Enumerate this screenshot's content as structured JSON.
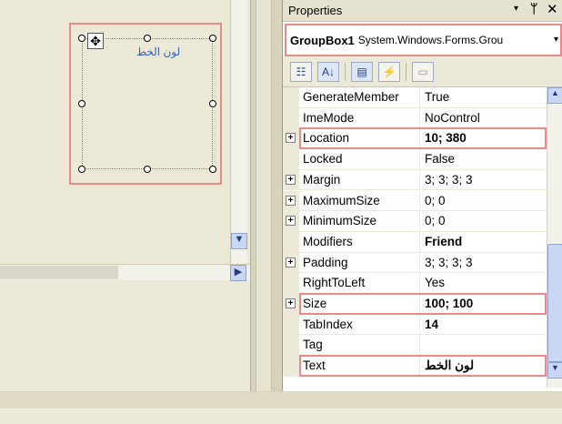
{
  "properties_panel": {
    "title": "Properties",
    "selected_object": {
      "name": "GroupBox1",
      "type": "System.Windows.Forms.Grou"
    },
    "rows": [
      {
        "name": "GenerateMember",
        "value": "True",
        "expandable": false,
        "bold": false
      },
      {
        "name": "ImeMode",
        "value": "NoControl",
        "expandable": false,
        "bold": false
      },
      {
        "name": "Location",
        "value": "10; 380",
        "expandable": true,
        "bold": true,
        "highlighted": true
      },
      {
        "name": "Locked",
        "value": "False",
        "expandable": false,
        "bold": false
      },
      {
        "name": "Margin",
        "value": "3; 3; 3; 3",
        "expandable": true,
        "bold": false
      },
      {
        "name": "MaximumSize",
        "value": "0; 0",
        "expandable": true,
        "bold": false
      },
      {
        "name": "MinimumSize",
        "value": "0; 0",
        "expandable": true,
        "bold": false
      },
      {
        "name": "Modifiers",
        "value": "Friend",
        "expandable": false,
        "bold": true
      },
      {
        "name": "Padding",
        "value": "3; 3; 3; 3",
        "expandable": true,
        "bold": false
      },
      {
        "name": "RightToLeft",
        "value": "Yes",
        "expandable": false,
        "bold": false
      },
      {
        "name": "Size",
        "value": "100; 100",
        "expandable": true,
        "bold": true,
        "highlighted": true
      },
      {
        "name": "TabIndex",
        "value": "14",
        "expandable": false,
        "bold": true
      },
      {
        "name": "Tag",
        "value": "",
        "expandable": false,
        "bold": false
      },
      {
        "name": "Text",
        "value": "لون الخط",
        "expandable": false,
        "bold": true,
        "highlighted": true
      }
    ]
  },
  "designer": {
    "groupbox_caption": "لون الخط"
  },
  "icons": {
    "dropdown": "▾",
    "pin": "ᛘ",
    "close": "✕",
    "expand": "+",
    "scroll_up": "▲",
    "scroll_down": "▼",
    "scroll_right": "▶",
    "move": "✥",
    "categorized": "☷",
    "alphabetical": "A↓",
    "properties": "▤",
    "events": "⚡",
    "property_pages": "▭"
  },
  "colors": {
    "highlight_border": "#e88a8a",
    "caption_text": "#3a63c0"
  }
}
